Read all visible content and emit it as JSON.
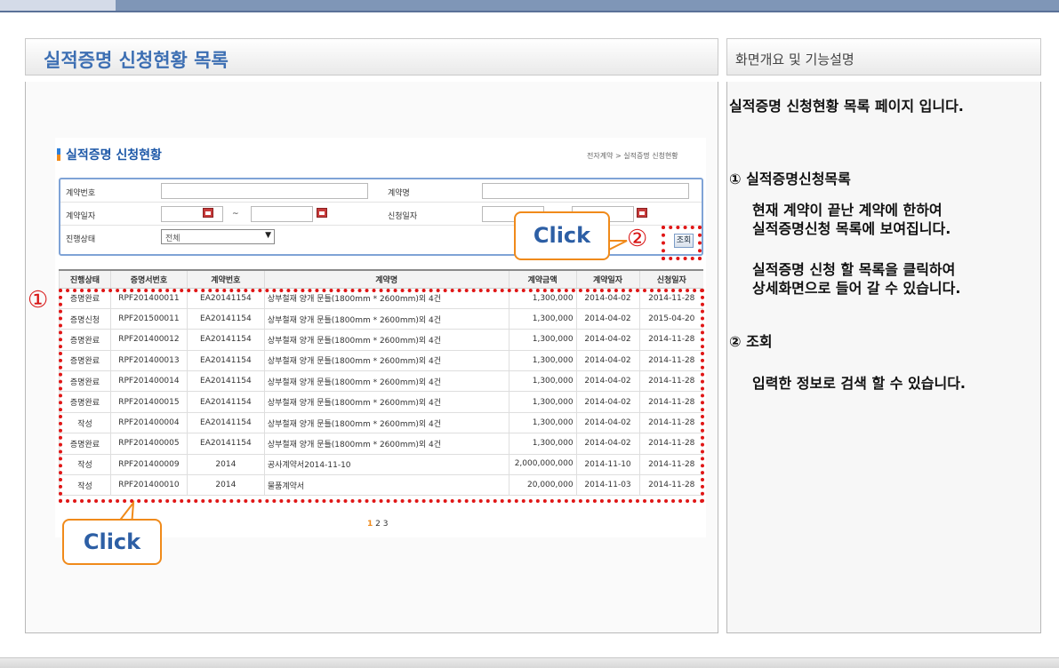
{
  "header": {
    "title": "실적증명 신청현황 목록",
    "desc_title": "화면개요 및 기능설명"
  },
  "screen": {
    "title": "실적증명 신청현황",
    "breadcrumb": "전자계약 > 실적증명 신청현황",
    "search": {
      "contract_no_label": "계약번호",
      "contract_name_label": "계약명",
      "contract_date_label": "계약일자",
      "request_date_label": "신청일자",
      "status_label": "진행상태",
      "status_value": "전체",
      "range_sep": "~",
      "search_button": "조회"
    },
    "table": {
      "columns": [
        "진행상태",
        "증명서번호",
        "계약번호",
        "계약명",
        "계약금액",
        "계약일자",
        "신청일자"
      ],
      "rows": [
        [
          "증명완료",
          "RPF201400011",
          "EA20141154",
          "상부철재 양개 문틀(1800mm * 2600mm)외 4건",
          "1,300,000",
          "2014-04-02",
          "2014-11-28"
        ],
        [
          "증명신청",
          "RPF201500011",
          "EA20141154",
          "상부철재 양개 문틀(1800mm * 2600mm)외 4건",
          "1,300,000",
          "2014-04-02",
          "2015-04-20"
        ],
        [
          "증명완료",
          "RPF201400012",
          "EA20141154",
          "상부철재 양개 문틀(1800mm * 2600mm)외 4건",
          "1,300,000",
          "2014-04-02",
          "2014-11-28"
        ],
        [
          "증명완료",
          "RPF201400013",
          "EA20141154",
          "상부철재 양개 문틀(1800mm * 2600mm)외 4건",
          "1,300,000",
          "2014-04-02",
          "2014-11-28"
        ],
        [
          "증명완료",
          "RPF201400014",
          "EA20141154",
          "상부철재 양개 문틀(1800mm * 2600mm)외 4건",
          "1,300,000",
          "2014-04-02",
          "2014-11-28"
        ],
        [
          "증명완료",
          "RPF201400015",
          "EA20141154",
          "상부철재 양개 문틀(1800mm * 2600mm)외 4건",
          "1,300,000",
          "2014-04-02",
          "2014-11-28"
        ],
        [
          "작성",
          "RPF201400004",
          "EA20141154",
          "상부철재 양개 문틀(1800mm * 2600mm)외 4건",
          "1,300,000",
          "2014-04-02",
          "2014-11-28"
        ],
        [
          "증명완료",
          "RPF201400005",
          "EA20141154",
          "상부철재 양개 문틀(1800mm * 2600mm)외 4건",
          "1,300,000",
          "2014-04-02",
          "2014-11-28"
        ],
        [
          "작성",
          "RPF201400009",
          "2014",
          "공사계약서2014-11-10",
          "2,000,000,000",
          "2014-11-10",
          "2014-11-28"
        ],
        [
          "작성",
          "RPF201400010",
          "2014",
          "물품계약서",
          "20,000,000",
          "2014-11-03",
          "2014-11-28"
        ]
      ]
    },
    "pager": {
      "current": "1",
      "others": "2 3"
    }
  },
  "annotations": {
    "click": "Click",
    "marker1": "①",
    "marker2": "②"
  },
  "description": {
    "intro": "실적증명 신청현황 목록 페이지 입니다.",
    "s1_title": "① 실적증명신청목록",
    "s1_line1": "현재 계약이 끝난 계약에 한하여",
    "s1_line2": "실적증명신청 목록에 보여집니다.",
    "s1_line3": "실적증명 신청 할 목록을 클릭하여",
    "s1_line4": "상세화면으로 들어 갈 수 있습니다.",
    "s2_title": "② 조회",
    "s2_line1": "입력한 정보로 검색 할 수 있습니다."
  }
}
